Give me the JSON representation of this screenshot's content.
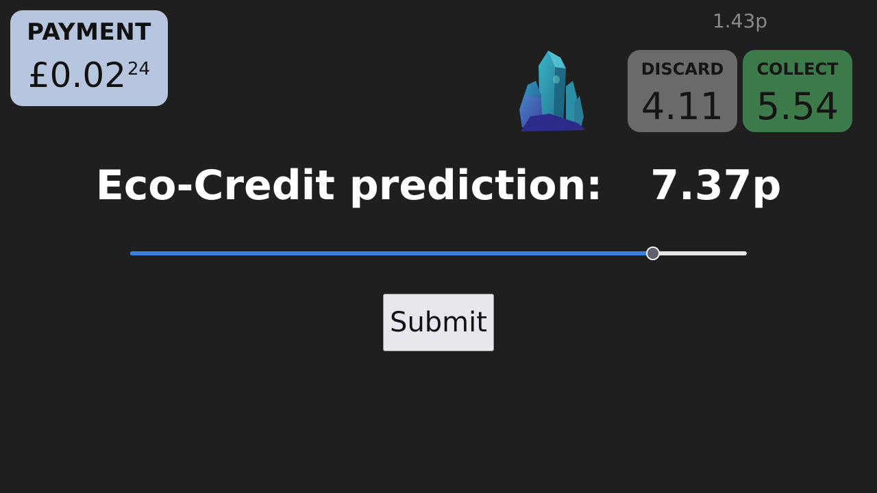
{
  "payment": {
    "label": "PAYMENT",
    "amount_main": "£0.02",
    "amount_sup": "24"
  },
  "top_readout": "1.43p",
  "crystal_icon": "crystal-icon",
  "cards": {
    "discard": {
      "label": "DISCARD",
      "value": "4.11",
      "color": "#6a6a6a"
    },
    "collect": {
      "label": "COLLECT",
      "value": "5.54",
      "color": "#3d7a49"
    }
  },
  "prediction": {
    "label": "Eco-Credit prediction:",
    "value": "7.37p"
  },
  "slider": {
    "fraction": 0.848,
    "fill_color": "#3b7fe0"
  },
  "submit_label": "Submit"
}
